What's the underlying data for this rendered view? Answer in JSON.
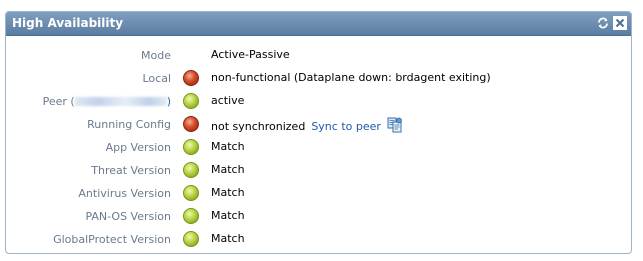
{
  "widget": {
    "title": "High Availability",
    "refresh_icon": "refresh-icon",
    "close_icon": "close-icon"
  },
  "rows": [
    {
      "label": "Mode",
      "status": null,
      "value": "Active-Passive"
    },
    {
      "label": "Local",
      "status": "red",
      "value": "non-functional (Dataplane down: brdagent exiting)"
    },
    {
      "label_prefix": "Peer (",
      "label_suffix": ")",
      "status": "green",
      "value": "active"
    },
    {
      "label": "Running Config",
      "status": "red",
      "value": "not synchronized",
      "action": "Sync to peer",
      "action_icon": "sync-to-peer-icon"
    },
    {
      "label": "App Version",
      "status": "green",
      "value": "Match"
    },
    {
      "label": "Threat Version",
      "status": "green",
      "value": "Match"
    },
    {
      "label": "Antivirus Version",
      "status": "green",
      "value": "Match"
    },
    {
      "label": "PAN-OS Version",
      "status": "green",
      "value": "Match"
    },
    {
      "label": "GlobalProtect Version",
      "status": "green",
      "value": "Match"
    }
  ],
  "colors": {
    "header": "#6a8db3",
    "label": "#6b7b8c",
    "link": "#1e5aa8",
    "status_green": "#a8c43a",
    "status_red": "#c0401f"
  }
}
